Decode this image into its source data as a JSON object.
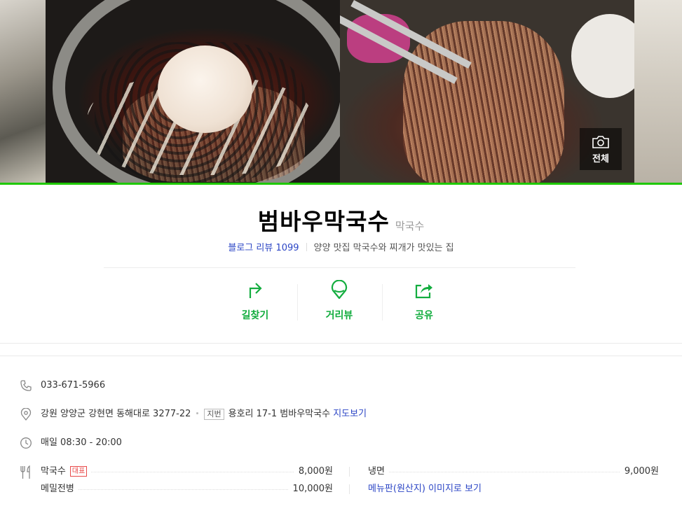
{
  "gallery": {
    "view_all_label": "전체"
  },
  "place": {
    "name": "범바우막국수",
    "category": "막국수",
    "blog_review_label": "블로그 리뷰",
    "blog_review_count": "1099",
    "tagline": "양양 맛집 막국수와 찌개가 맛있는 집"
  },
  "actions": [
    {
      "label": "길찾기",
      "icon": "directions-icon"
    },
    {
      "label": "거리뷰",
      "icon": "street-view-icon"
    },
    {
      "label": "공유",
      "icon": "share-icon"
    }
  ],
  "info": {
    "phone": "033-671-5966",
    "address_road": "강원 양양군 강현면 동해대로 3277-22",
    "address_badge": "지번",
    "address_lot": "용호리 17-1 범바우막국수",
    "map_link": "지도보기",
    "hours": "매일 08:30 - 20:00"
  },
  "menu": {
    "items": [
      {
        "name": "막국수",
        "badge": "대표",
        "price": "8,000원"
      },
      {
        "name": "냉면",
        "price": "9,000원"
      },
      {
        "name": "메밀전병",
        "price": "10,000원"
      }
    ],
    "menu_board_link": "메뉴판(원산지) 이미지로 보기"
  },
  "colors": {
    "accent_green": "#1ec800",
    "action_green": "#13ad3f",
    "link_blue": "#2b45c5"
  }
}
